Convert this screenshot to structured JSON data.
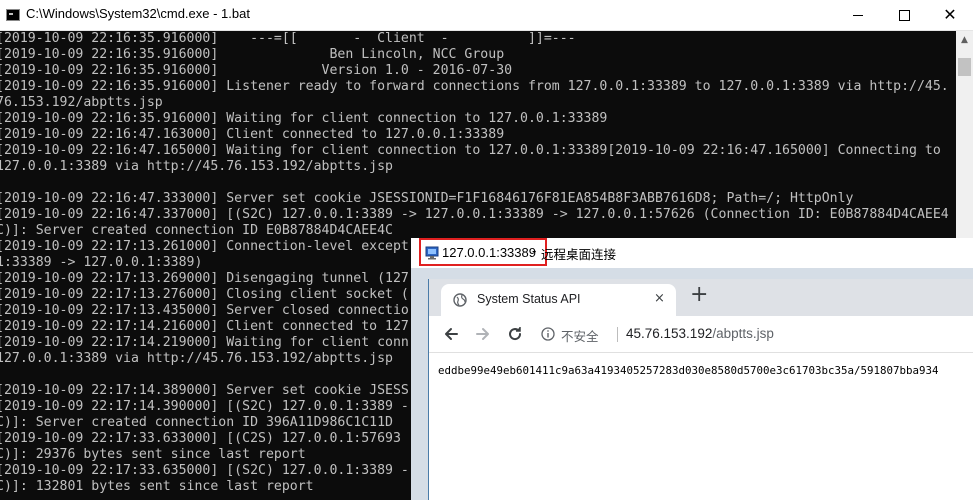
{
  "cmd": {
    "title": "C:\\Windows\\System32\\cmd.exe - 1.bat",
    "lines": [
      "[2019-10-09 22:16:35.916000]    ---=[[       -  Client  -          ]]=--- ",
      "[2019-10-09 22:16:35.916000]              Ben Lincoln, NCC Group",
      "[2019-10-09 22:16:35.916000]             Version 1.0 - 2016-07-30",
      "[2019-10-09 22:16:35.916000] Listener ready to forward connections from 127.0.0.1:33389 to 127.0.0.1:3389 via http://45.",
      "76.153.192/abptts.jsp",
      "[2019-10-09 22:16:35.916000] Waiting for client connection to 127.0.0.1:33389",
      "[2019-10-09 22:16:47.163000] Client connected to 127.0.0.1:33389",
      "[2019-10-09 22:16:47.165000] Waiting for client connection to 127.0.0.1:33389[2019-10-09 22:16:47.165000] Connecting to",
      "127.0.0.1:3389 via http://45.76.153.192/abptts.jsp",
      "",
      "[2019-10-09 22:16:47.333000] Server set cookie JSESSIONID=F1F16846176F81EA854B8F3ABB7616D8; Path=/; HttpOnly",
      "[2019-10-09 22:16:47.337000] [(S2C) 127.0.0.1:3389 -> 127.0.0.1:33389 -> 127.0.0.1:57626 (Connection ID: E0B87884D4CAEE4",
      "C)]: Server created connection ID E0B87884D4CAEE4C",
      "[2019-10-09 22:17:13.261000] Connection-level except",
      "1:33389 -> 127.0.0.1:3389)",
      "[2019-10-09 22:17:13.269000] Disengaging tunnel (127",
      "[2019-10-09 22:17:13.276000] Closing client socket (",
      "[2019-10-09 22:17:13.435000] Server closed connectio",
      "[2019-10-09 22:17:14.216000] Client connected to 127",
      "[2019-10-09 22:17:14.219000] Waiting for client conn",
      "127.0.0.1:3389 via http://45.76.153.192/abptts.jsp",
      "",
      "[2019-10-09 22:17:14.389000] Server set cookie JSESS",
      "[2019-10-09 22:17:14.390000] [(S2C) 127.0.0.1:3389 -",
      "C)]: Server created connection ID 396A11D986C1C11D",
      "[2019-10-09 22:17:33.633000] [(C2S) 127.0.0.1:57693",
      "C)]: 29376 bytes sent since last report",
      "[2019-10-09 22:17:33.635000] [(S2C) 127.0.0.1:3389 -",
      "C)]: 132801 bytes sent since last report"
    ]
  },
  "rdp": {
    "host": "127.0.0.1:33389",
    "separator": "-",
    "title": "远程桌面连接"
  },
  "browser": {
    "tab_title": "System Status API",
    "tab_close": "×",
    "new_tab": "+",
    "not_secure": "不安全",
    "url_host": "45.76.153.192",
    "url_path": "/abptts.jsp",
    "body_text": "eddbe99e49eb601411c9a63a4193405257283d030e8580d5700e3c61703bc35a/591807bba934"
  },
  "icons": {
    "cmd": "terminal-icon",
    "rdp": "remote-desktop-icon",
    "tab": "globe-icon",
    "info": "info-icon"
  },
  "colors": {
    "console_bg": "#0c0c0c",
    "console_text": "#c0c0c0",
    "highlight_border": "#e02020",
    "tabstrip": "#dee1e6"
  }
}
